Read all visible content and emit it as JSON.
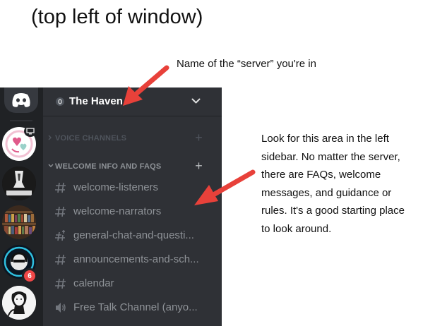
{
  "annotations": {
    "heading": "(top left of window)",
    "server_name_note": "Name of the “server” you're in",
    "sidebar_note_lines": [
      "Look for this area in the left",
      "sidebar.  No matter the server,",
      "there are FAQs, welcome",
      "messages, and guidance or",
      "rules.  It's a good starting place",
      "to look around."
    ],
    "arrow_color": "#e8413a"
  },
  "server": {
    "name": "The Haven",
    "categories": [
      {
        "label": "VOICE CHANNELS",
        "collapsed": true
      },
      {
        "label": "WELCOME INFO AND FAQS",
        "collapsed": false
      }
    ],
    "channels": [
      {
        "icon": "text-channel-icon",
        "label": "welcome-listeners"
      },
      {
        "icon": "text-channel-icon",
        "label": "welcome-narrators"
      },
      {
        "icon": "text-channel-thread-icon",
        "label": "general-chat-and-questi..."
      },
      {
        "icon": "text-channel-icon",
        "label": "announcements-and-sch..."
      },
      {
        "icon": "text-channel-icon",
        "label": "calendar"
      },
      {
        "icon": "voice-channel-icon",
        "label": "Free Talk Channel (anyo..."
      }
    ]
  },
  "server_rail": {
    "icons": [
      "discord-home-icon",
      "server-icon-hearts",
      "server-icon-cryptid",
      "server-icon-library",
      "server-icon-dj",
      "server-icon-sketch"
    ],
    "badges": {
      "dj_unread": "6"
    }
  },
  "colors": {
    "rail_bg": "#202225",
    "sidebar_bg": "#2f3136",
    "channel_text": "#8e9297",
    "category_text": "#72767d",
    "header_text": "#ffffff",
    "badge_red": "#f04747",
    "blurple": "#7289da"
  }
}
